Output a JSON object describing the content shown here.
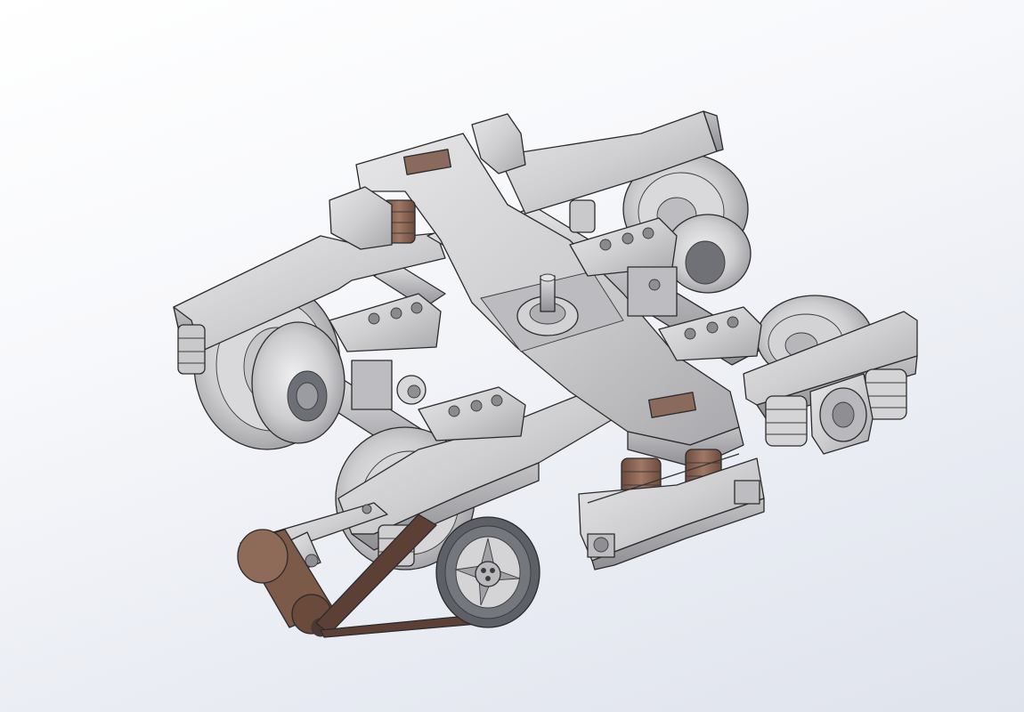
{
  "scene": {
    "background_top": "#ffffff",
    "background_bottom": "#dfe3ec",
    "metal_color": "#cfcfd1",
    "metal_shadow": "#a9a9ad",
    "spring_color": "#8a6455",
    "brake_color": "#7b5a4a",
    "pulley_color": "#5d6066"
  }
}
